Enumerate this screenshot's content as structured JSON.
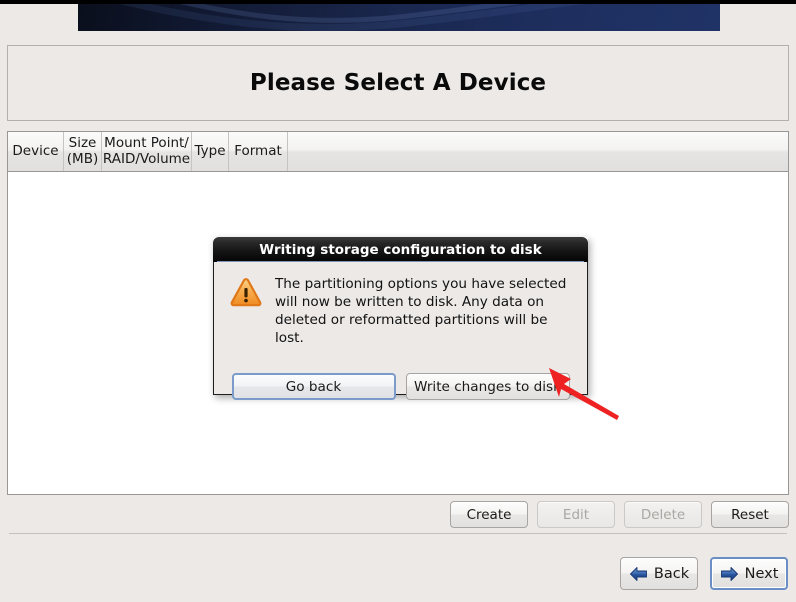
{
  "colors": {
    "banner_dark": "#0a0f1c",
    "banner_light": "#203366",
    "page_background": "#ece9e7",
    "annotation_arrow": "#ee2222",
    "warning_orange": "#f08b2c",
    "focus_blue": "#7b9ccb",
    "nav_arrow_blue": "#2b5aa8"
  },
  "banner": {
    "name": "installer-banner"
  },
  "page_title": "Please Select A Device",
  "table": {
    "columns": [
      {
        "label": "Device"
      },
      {
        "label": "Size\n(MB)"
      },
      {
        "label": "Mount Point/\nRAID/Volume"
      },
      {
        "label": "Type"
      },
      {
        "label": "Format"
      }
    ],
    "rows": []
  },
  "action_buttons": [
    {
      "label": "Create",
      "enabled": true
    },
    {
      "label": "Edit",
      "enabled": false
    },
    {
      "label": "Delete",
      "enabled": false
    },
    {
      "label": "Reset",
      "enabled": true
    }
  ],
  "nav_buttons": {
    "back": {
      "label": "Back",
      "icon": "arrow-left-icon",
      "focused": false
    },
    "next": {
      "label": "Next",
      "icon": "arrow-right-icon",
      "focused": true
    }
  },
  "dialog": {
    "title": "Writing storage configuration to disk",
    "icon": "warning-triangle-icon",
    "message": "The partitioning options you have selected\nwill now be written to disk.  Any data on\ndeleted or reformatted partitions will be lost.",
    "buttons": {
      "go_back": {
        "label": "Go back",
        "focused": true
      },
      "write": {
        "label": "Write changes to disk",
        "focused": false
      }
    }
  },
  "annotation": {
    "type": "red-arrow",
    "points_to": "Write changes to disk"
  }
}
